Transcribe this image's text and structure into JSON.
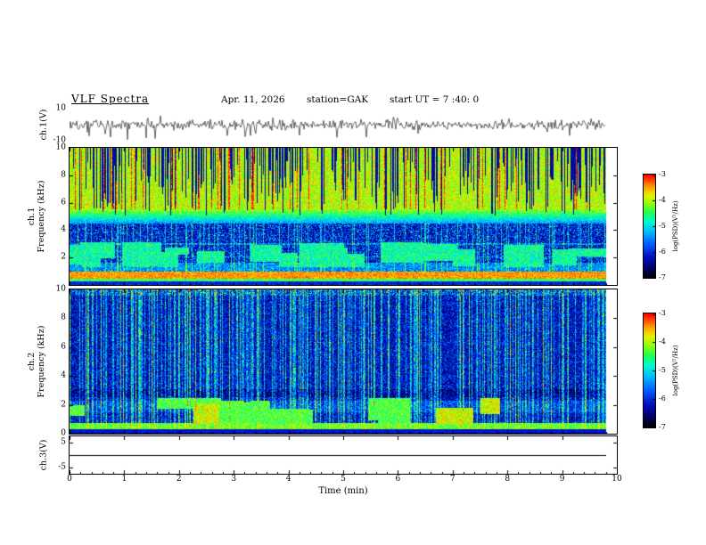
{
  "header": {
    "title": "VLF  Spectra",
    "date": "Apr. 11, 2026",
    "station": "station=GAK",
    "start_ut": "start UT =  7 :40: 0"
  },
  "xaxis": {
    "label": "Time (min)",
    "lim": [
      0,
      10
    ],
    "ticks": [
      0,
      1,
      2,
      3,
      4,
      5,
      6,
      7,
      8,
      9,
      10
    ],
    "data_end_min": 9.8
  },
  "colorbar": {
    "label": "log(PSD)(V²/Hz)",
    "lim": [
      -7,
      -3
    ],
    "ticks": [
      -3,
      -4,
      -5,
      -6,
      -7
    ]
  },
  "colormap": {
    "stops": [
      {
        "t": 0.0,
        "c": "#000000"
      },
      {
        "t": 0.08,
        "c": "#000060"
      },
      {
        "t": 0.2,
        "c": "#0010c0"
      },
      {
        "t": 0.33,
        "c": "#0060ff"
      },
      {
        "t": 0.45,
        "c": "#00c0ff"
      },
      {
        "t": 0.55,
        "c": "#00ffc8"
      },
      {
        "t": 0.63,
        "c": "#20ff50"
      },
      {
        "t": 0.72,
        "c": "#90ff10"
      },
      {
        "t": 0.8,
        "c": "#e8f000"
      },
      {
        "t": 0.88,
        "c": "#ffa000"
      },
      {
        "t": 1.0,
        "c": "#ff0000"
      }
    ]
  },
  "chart_data": [
    {
      "id": "ch1_waveform",
      "type": "line",
      "ylabel": "ch.1(V)",
      "ylim": [
        -10,
        10
      ],
      "yticks": [
        10,
        -10
      ],
      "seed": 11,
      "description": "Broadband noise waveform, amplitude mostly within ±3 V, with sporadic negative spikes reaching about -9 V over 0-9.8 min"
    },
    {
      "id": "ch1_spectrogram",
      "type": "heatmap",
      "ylabel_line1": "ch.1",
      "ylabel_line2": "Frequency (kHz)",
      "ylim": [
        0,
        10
      ],
      "yticks": [
        10,
        8,
        6,
        4,
        2
      ],
      "zlim": [
        -7,
        -3
      ],
      "seed": 23,
      "streak_prob": 0.42,
      "patch_count": 20,
      "features": {
        "high_band": {
          "range_khz": [
            5.5,
            10
          ],
          "level": -4.45,
          "desc": "bright green/yellow hiss band cut by many dark vertical dropout streaks"
        },
        "mid_band": {
          "range_khz": [
            1.6,
            4.5
          ],
          "level": -6.4,
          "desc": "dark blue background with speckle and faint cyan vertical streaks"
        },
        "red_band": {
          "range_khz": [
            0.45,
            1.0
          ],
          "level": -3.8,
          "desc": "intense continuous red/orange band"
        },
        "bottom_band": {
          "range_khz": [
            0.25,
            0.45
          ],
          "level": -4.9,
          "desc": "green band near 0 kHz"
        }
      }
    },
    {
      "id": "ch2_spectrogram",
      "type": "heatmap",
      "ylabel_line1": "ch.2",
      "ylabel_line2": "Frequency (kHz)",
      "ylim": [
        0,
        10
      ],
      "yticks": [
        10,
        8,
        6,
        4,
        2,
        0
      ],
      "zlim": [
        -7,
        -3
      ],
      "seed": 57,
      "streak_prob": 0.38,
      "patch_count": 12,
      "features": {
        "background": {
          "level": -6.5,
          "desc": "mostly dark blue/black with dense cyan-green full-height vertical impulse streaks"
        },
        "bright_patches": {
          "range_khz": [
            0.8,
            2.4
          ],
          "level": -4.8,
          "desc": "green/yellow patch clusters near 1-2 kHz around t=2.5-3.3 and 4-5 min"
        },
        "bottom_band": {
          "range_khz": [
            0.3,
            0.75
          ],
          "level": -4.75,
          "desc": "green band with yellow segments near 0.5 kHz"
        }
      }
    },
    {
      "id": "ch3_line",
      "type": "line",
      "ylabel": "ch.3(V)",
      "ylim": [
        -7.5,
        7.5
      ],
      "yticks": [
        5,
        -5
      ],
      "value": 0,
      "description": "Flat line at 0 V for the whole interval"
    }
  ]
}
